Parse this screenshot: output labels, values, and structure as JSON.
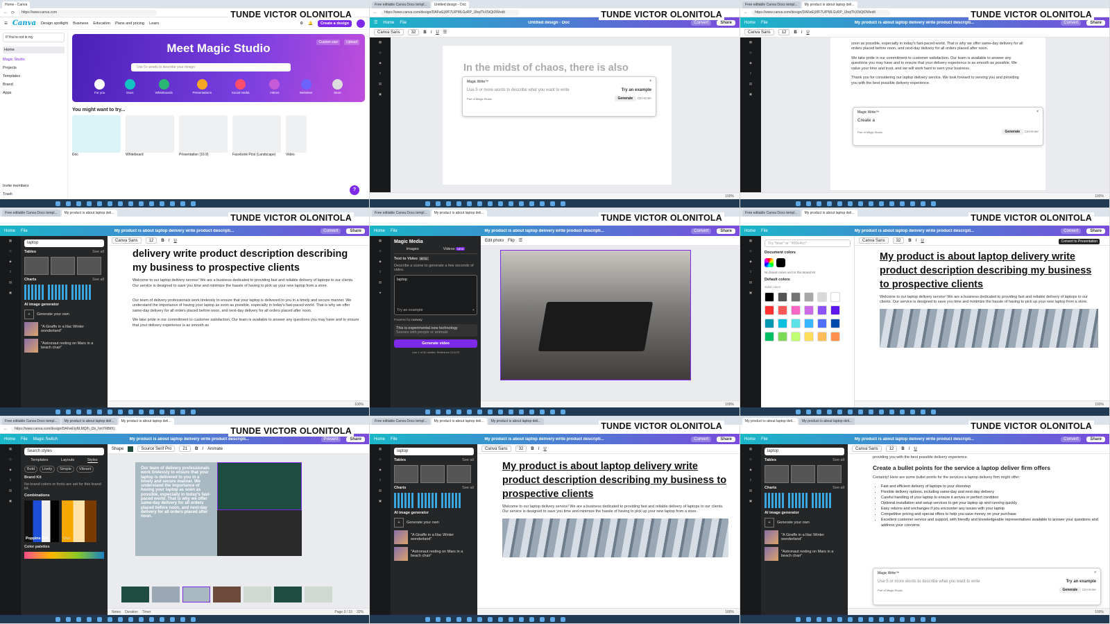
{
  "watermark": "TUNDE VICTOR OLONITOLA",
  "cells": [
    {
      "tabs": [
        "Home - Canva",
        ""
      ],
      "url": "https://www.canva.com",
      "nav": [
        "Design spotlight",
        "Business",
        "Education",
        "Plans and pricing",
        "Learn"
      ],
      "create_btn": "Create a design",
      "sidebar_user": "If You're not in my",
      "sidebar_items": [
        "Home",
        "Magic Studio",
        "Projects",
        "Templates",
        "Brand",
        "Apps"
      ],
      "invite": "Invite members",
      "trash": "Trash",
      "hero_title": "Meet Magic Studio",
      "hero_custom": "Custom size",
      "hero_upload": "Upload",
      "hero_search": "Use 5+ words to describe your design",
      "hero_icons": [
        "For you",
        "Docs",
        "Whiteboards",
        "Presentations",
        "Social media",
        "Videos",
        "Websites",
        "More"
      ],
      "try_title": "You might want to try...",
      "try_items": [
        "Doc",
        "Whiteboard",
        "Presentation (16:9)",
        "Facebook Post (Landscape)",
        "Video"
      ]
    },
    {
      "tabs": [
        "Free editable Canva Docs templ...",
        "Untitled design - Doc"
      ],
      "url": "https://www.canva.com/design/DAFwEjXfF7U/PMLGvRP_Ubq/TkX5tQtDWedit",
      "title": "Untitled design - Doc",
      "font": "Canva Sans",
      "size": "32",
      "headline": "In the midst of chaos, there is also",
      "mw_label": "Magic Write™",
      "mw_placeholder": "Use 5 or more words to describe what you want to write",
      "mw_try": "Try an example",
      "mw_foot": "Part of Magic Studio",
      "mw_generate": "Generate",
      "mw_shortcut": "Ctrl+Enter",
      "zoom": "100%"
    },
    {
      "tabs": [
        "Free editable Canva Docs templ...",
        "My product is about laptop deli..."
      ],
      "url": "https://www.canva.com/design/DAFwEjXfF7U/PMLGvRP_Ubq/TkX5tQtDWedit",
      "title": "My product is about laptop delivery write product descripti...",
      "font": "Canva Sans",
      "size": "12",
      "p1": "soon as possible, especially in today's fast-paced world. That is why we offer same-day delivery for all orders placed before noon, and next-day delivery for all orders placed after noon.",
      "p2": "We take pride in our commitment to customer satisfaction. Our team is available to answer any questions you may have and to ensure that your delivery experience is as smooth as possible. We value your time and trust, and we will work hard to earn your business.",
      "p3": "Thank you for considering our laptop delivery service. We look forward to serving you and providing you with the best possible delivery experience.",
      "mw_label": "Magic Write™",
      "mw_input": "Create a",
      "mw_foot": "Part of Magic Studio",
      "mw_generate": "Generate",
      "mw_shortcut": "Ctrl+Enter",
      "zoom": "100%"
    },
    {
      "tabs": [
        "Free editable Canva Docs templ...",
        "My product is about laptop deli..."
      ],
      "title": "My product is about laptop delivery write product descripti...",
      "search": "laptop",
      "tables": "Tables",
      "charts": "Charts",
      "see_all": "See all",
      "ai_gen": "AI image generator",
      "gen_own": "Generate your own",
      "ai1": "\"A Giraffe in a lilac Winter wonderland\"",
      "ai2": "\"Astronaut resting on Mars in a beach chair\"",
      "font": "Canva Sans",
      "size": "12",
      "heading": "delivery write product description describing my business to prospective clients",
      "p1": "Welcome to our laptop delivery service! We are a business dedicated to providing fast and reliable delivery of laptops to our clients. Our service is designed to save you time and minimize the hassle of having to pick up your new laptop from a store.",
      "p2": "Our team of delivery professionals work tirelessly to ensure that your laptop is delivered to you in a timely and secure manner. We understand the importance of having your laptop as soon as possible, especially in today's fast-paced world. That is why we offer same-day delivery for all orders placed before noon, and next-day delivery for all orders placed after noon.",
      "p3": "We take pride in our commitment to customer satisfaction. Our team is available to answer any questions you may have and to ensure that your delivery experience is as smooth as",
      "zoom": "100%"
    },
    {
      "tabs": [
        "Free editable Canva Docs templ...",
        "My product is about laptop deli..."
      ],
      "title": "My product is about laptop delivery write product descripti...",
      "panel_title": "Magic Media",
      "tab_images": "Images",
      "tab_videos": "Videos",
      "badge_new": "NEW",
      "t2v": "Text to Video",
      "beta": "BETA",
      "describe": "Describe a scene to generate a few seconds of video.",
      "input": "laptop",
      "try": "Try an example",
      "powered": "Powered by",
      "runway": "runway",
      "experimental": "This is experimental new technology",
      "scenes": "Scenes with people or animals",
      "gen_video": "Generate video",
      "credits": "Use 1 of 50 credits. Refreshes 11/1/23",
      "edit_photo": "Edit photo",
      "flip": "Flip",
      "zoom": "100%"
    },
    {
      "tabs": [
        "Free editable Canva Docs templ...",
        "My product is about laptop deli..."
      ],
      "title": "My product is about laptop delivery write product descripti...",
      "tooltip": "Convert to Presentation",
      "search": "Try \"blue\" or \"#00c4cc\"",
      "doc_colors": "Document colors",
      "no_brand": "No brand colors set for this Brand Kit",
      "default_colors": "Default colors",
      "solid": "Solid colors",
      "font": "Canva Sans",
      "size": "32",
      "heading": "My product is about laptop delivery write product description describing my business to prospective clients",
      "p1": "Welcome to our laptop delivery service! We are a business dedicated to providing fast and reliable delivery of laptops to our clients. Our service is designed to save you time and minimize the hassle of having to pick up your new laptop from a store.",
      "swatches": [
        "#000000",
        "#545454",
        "#737373",
        "#a6a6a6",
        "#d9d9d9",
        "#ffffff",
        "#ff3131",
        "#ff5757",
        "#ff66c4",
        "#cb6ce6",
        "#8c52ff",
        "#5e17eb",
        "#0097b2",
        "#0cc0df",
        "#5ce1e6",
        "#38b6ff",
        "#5170ff",
        "#004aad",
        "#00bf63",
        "#7ed957",
        "#c1ff72",
        "#ffde59",
        "#ffbd59",
        "#ff914d"
      ],
      "zoom": "100%"
    },
    {
      "tabs": [
        "Free editable Canva Docs templ...",
        "My product is about laptop deli...",
        "My product is about laptop deli..."
      ],
      "url": "https://www.canva.com/design/DAFwEtyBLMQ/h_t3x_hmYRfbfXSSE...",
      "magic_switch": "Magic Switch",
      "title": "My product is about laptop delivery write product descripti...",
      "present": "Present",
      "search": "Search styles",
      "tabs_panel": [
        "Templates",
        "Layouts",
        "Styles"
      ],
      "chips": [
        "Bold",
        "Lively",
        "Simple",
        "Vibrant"
      ],
      "brand_kit": "Brand Kit",
      "no_fonts": "No brand colors or fonts are set for this brand kit.",
      "combinations": "Combinations",
      "combo1": "Poppins Bol",
      "combo2": "Ovo",
      "color_palettes": "Color palettes",
      "shape": "Shape",
      "font": "Source Serif Pro",
      "size": "21",
      "animate": "Animate",
      "slide_text": "Our team of delivery professionals work tirelessly to ensure that your laptop is delivered to you in a timely and secure manner. We understand the importance of having your laptop as soon as possible, especially in today's fast-paced world. That is why we offer same-day delivery for all orders placed before noon, and next-day delivery for all orders placed after noon.",
      "notes": "Notes",
      "duration": "Duration",
      "timer": "Timer",
      "page": "Page 3 / 15",
      "zoom": "32%"
    },
    {
      "tabs": [
        "Free editable Canva Docs templ...",
        "My product is about laptop deli...",
        "My product is about laptop deli..."
      ],
      "title": "My product is about laptop delivery write product descripti...",
      "search": "laptop",
      "tables": "Tables",
      "charts": "Charts",
      "see_all": "See all",
      "ai_gen": "AI image generator",
      "gen_own": "Generate your own",
      "ai1": "\"A Giraffe in a lilac Winter wonderland\"",
      "ai2": "\"Astronaut resting on Mars in a beach chair\"",
      "font": "Canva Sans",
      "size": "32",
      "heading": "My product is about laptop delivery write product description describing my business to prospective clients",
      "p1": "Welcome to our laptop delivery service! We are a business dedicated to providing fast and reliable delivery of laptops to our clients. Our service is designed to save you time and minimize the hassle of having to pick up your new laptop from a store.",
      "zoom": "100%"
    },
    {
      "tabs": [
        "My product is about laptop deli...",
        "My product is about laptop deli..."
      ],
      "title": "My product is about laptop delivery write product descripti...",
      "search": "laptop",
      "tables": "Tables",
      "charts": "Charts",
      "see_all": "See all",
      "ai_gen": "AI image generator",
      "gen_own": "Generate your own",
      "ai1": "\"A Giraffe in a lilac Winter wonderland\"",
      "ai2": "\"Astronaut resting on Mars in a beach chair\"",
      "font": "Canva Sans",
      "size": "12",
      "top": "providing you with the best possible delivery experience.",
      "sub": "Create a bullet points for the service a laptop deliver firm offers",
      "intro": "Certainly! Here are some bullet points for the services a laptop delivery firm might offer:",
      "bullets": [
        "Fast and efficient delivery of laptops to your doorstep",
        "Flexible delivery options, including same-day and next-day delivery",
        "Careful handling of your laptop to ensure it arrives in perfect condition",
        "Optional installation and setup services to get your laptop up and running quickly",
        "Easy returns and exchanges if you encounter any issues with your laptop",
        "Competitive pricing and special offers to help you save money on your purchase",
        "Excellent customer service and support, with friendly and knowledgeable representatives available to answer your questions and address your concerns"
      ],
      "mw_label": "Magic Write™",
      "mw_placeholder": "Use 5 or more words to describe what you want to write",
      "mw_try": "Try an example",
      "mw_foot": "Part of Magic Studio",
      "mw_generate": "Generate",
      "mw_shortcut": "Ctrl+Enter",
      "zoom": "100%"
    }
  ],
  "common": {
    "home": "Home",
    "file": "File",
    "share": "Share",
    "convert": "Convert"
  },
  "colors": {
    "canva_purple": "#7d2ae8",
    "hero": "#5b2bd1",
    "rail": "#18191b"
  }
}
